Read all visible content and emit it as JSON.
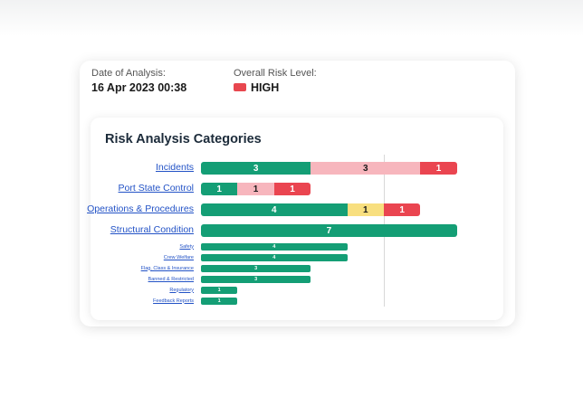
{
  "header": {
    "date_label": "Date of Analysis:",
    "date_value": "16 Apr 2023 00:38",
    "risk_label": "Overall Risk Level:",
    "risk_value": "HIGH",
    "risk_color": "#e8474f"
  },
  "panel": {
    "title": "Risk Analysis Categories"
  },
  "colors": {
    "green": "#149e75",
    "pink": "#f7b6bd",
    "yellow": "#f8df7f",
    "red": "#ea4550"
  },
  "chart_data": {
    "type": "bar",
    "stacked": true,
    "title": "Risk Analysis Categories",
    "categories": [
      "Incidents",
      "Port State Control",
      "Operations & Procedures",
      "Structural Condition",
      "Safety",
      "Crew Welfare",
      "Flag, Class & Insurance",
      "Banned & Restricted",
      "Regulatory",
      "Feedback Reports"
    ],
    "series": [
      {
        "color": "green",
        "values": [
          3,
          1,
          4,
          7,
          4,
          4,
          3,
          3,
          1,
          1
        ]
      },
      {
        "color": "pink",
        "values": [
          3,
          1,
          0,
          0,
          0,
          0,
          0,
          0,
          0,
          0
        ]
      },
      {
        "color": "yellow",
        "values": [
          0,
          0,
          1,
          0,
          0,
          0,
          0,
          0,
          0,
          0
        ]
      },
      {
        "color": "red",
        "values": [
          1,
          1,
          1,
          0,
          0,
          0,
          0,
          0,
          0,
          0
        ]
      }
    ],
    "reference_line": 5
  }
}
